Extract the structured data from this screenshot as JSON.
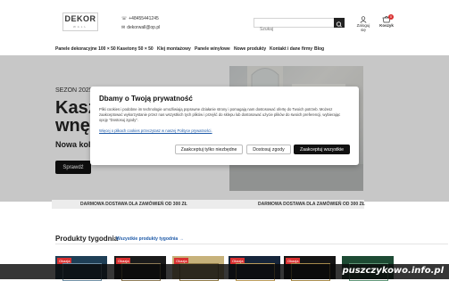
{
  "header": {
    "logo_main": "DEKOR",
    "logo_sub": "WALL",
    "phone": "+48455441245",
    "email": "dekorwall@op.pl",
    "search_placeholder": "Szukaj",
    "account_label": "Zaloguj się",
    "cart_label": "Koszyk",
    "cart_count": "0"
  },
  "nav": {
    "items": [
      "Panele dekoracyjne 100 × 50",
      "Kasetony 50 × 50",
      "Klej montażowy",
      "Panele winylowe",
      "Nowe produkty",
      "Kontakt i dane firmy",
      "Blog"
    ]
  },
  "hero": {
    "season": "SEZON 2025",
    "headline_1": "Kasz",
    "headline_2": "wnęt",
    "subheadline": "Nowa kole",
    "cta": "Sprawdź"
  },
  "shipping_bar": {
    "left": "DARMOWA DOSTAWA DLA ZAMÓWIEŃ OD 300 ZŁ",
    "right": "DARMOWA DOSTAWA DLA ZAMÓWIEŃ OD 300 ZŁ"
  },
  "products": {
    "title": "Produkty tygodnia",
    "link": "Wszystkie produkty tygodnia →",
    "badge": "Okazja"
  },
  "cookie_modal": {
    "title": "Dbamy o Twoją prywatność",
    "body": "Pliki cookies i podobne im technologie umożliwiają poprawne działanie strony i pomagają nam dostosować ofertę do Twoich potrzeb. Możesz zaakceptować wykorzystanie przez nas wszystkich tych plików i przejść do sklepu lub dostosować użycie plików do swoich preferencji, wybierając opcję \"Dostosuj zgody\".",
    "link": "Więcej o plikach cookies przeczytasz w naszej Polityce prywatności.",
    "btn_necessary": "Zaakceptuj tylko niezbędne",
    "btn_customize": "Dostosuj zgody",
    "btn_accept_all": "Zaakceptuj wszystkie"
  },
  "watermark": "puszczykowo.info.pl",
  "colors": {
    "accent": "#111111",
    "badge": "#d93030",
    "link": "#1e5aa8"
  }
}
